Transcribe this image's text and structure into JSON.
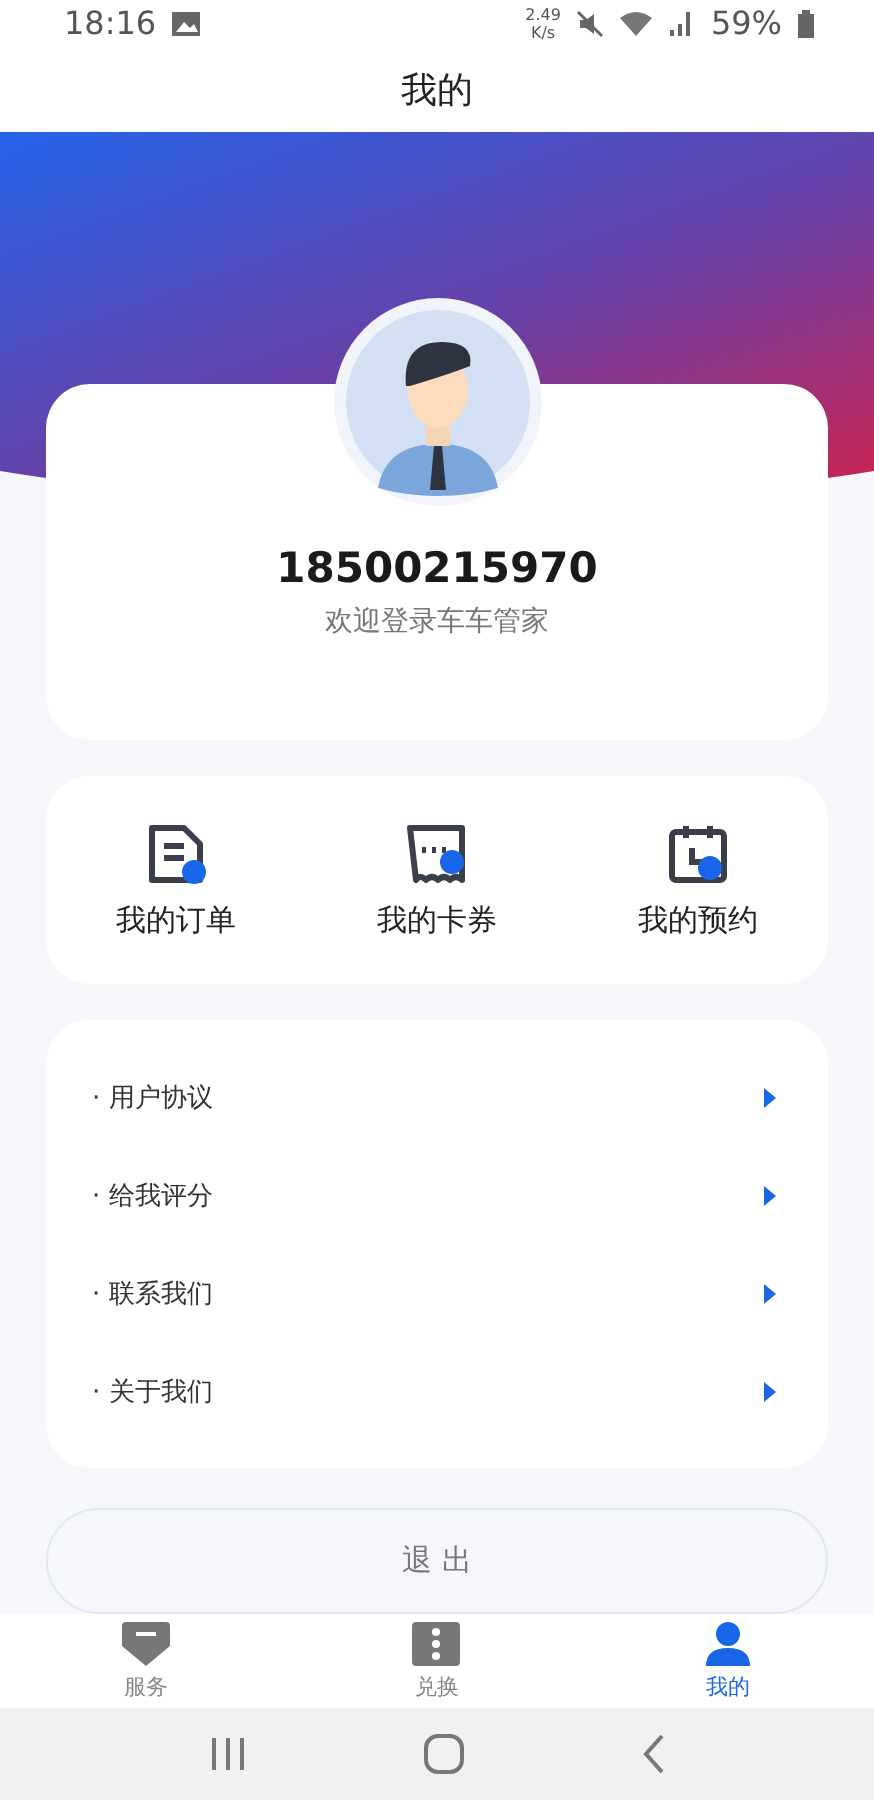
{
  "status_bar": {
    "time": "18:16",
    "speed": "2.49",
    "speed_unit": "K/s",
    "battery": "59%"
  },
  "header": {
    "title": "我的"
  },
  "profile": {
    "phone": "18500215970",
    "greeting": "欢迎登录车车管家"
  },
  "shortcuts": [
    {
      "kind": "orders",
      "label": "我的订单"
    },
    {
      "kind": "coupons",
      "label": "我的卡券"
    },
    {
      "kind": "bookings",
      "label": "我的预约"
    }
  ],
  "menu": [
    "· 用户协议",
    "· 给我评分",
    "· 联系我们",
    "· 关于我们"
  ],
  "logout": "退 出",
  "tabs": [
    {
      "kind": "service",
      "label": "服务",
      "selected": false
    },
    {
      "kind": "exchange",
      "label": "兑换",
      "selected": false
    },
    {
      "kind": "me",
      "label": "我的",
      "selected": true
    }
  ]
}
